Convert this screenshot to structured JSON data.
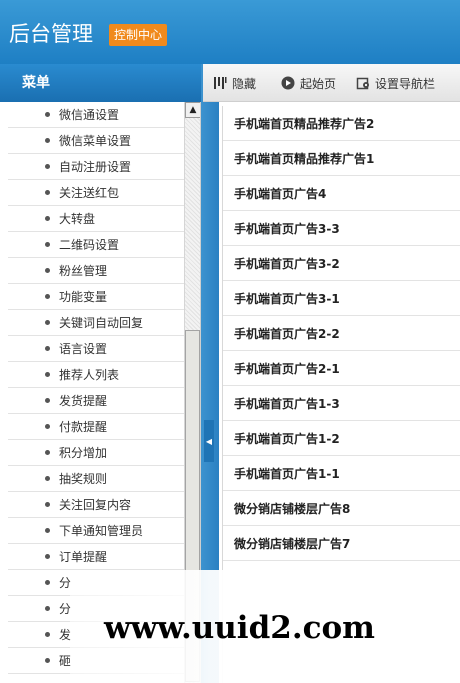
{
  "header": {
    "title": "后台管理",
    "badge": "控制中心"
  },
  "sidebar": {
    "heading": "菜单",
    "items": [
      "微信通设置",
      "微信菜单设置",
      "自动注册设置",
      "关注送红包",
      "大转盘",
      "二维码设置",
      "粉丝管理",
      "功能变量",
      "关键词自动回复",
      "语言设置",
      "推荐人列表",
      "发货提醒",
      "付款提醒",
      "积分增加",
      "抽奖规则",
      "关注回复内容",
      "下单通知管理员",
      "订单提醒",
      "分",
      "分",
      "发",
      "砸"
    ]
  },
  "toolbar": {
    "hide": "隐藏",
    "home": "起始页",
    "set_nav": "设置导航栏"
  },
  "list": {
    "rows": [
      "手机端首页精品推荐广告2",
      "手机端首页精品推荐广告1",
      "手机端首页广告4",
      "手机端首页广告3-3",
      "手机端首页广告3-2",
      "手机端首页广告3-1",
      "手机端首页广告2-2",
      "手机端首页广告2-1",
      "手机端首页广告1-3",
      "手机端首页广告1-2",
      "手机端首页广告1-1",
      "微分销店铺楼层广告8",
      "微分销店铺楼层广告7"
    ]
  },
  "watermark": "www.uuid2.com"
}
